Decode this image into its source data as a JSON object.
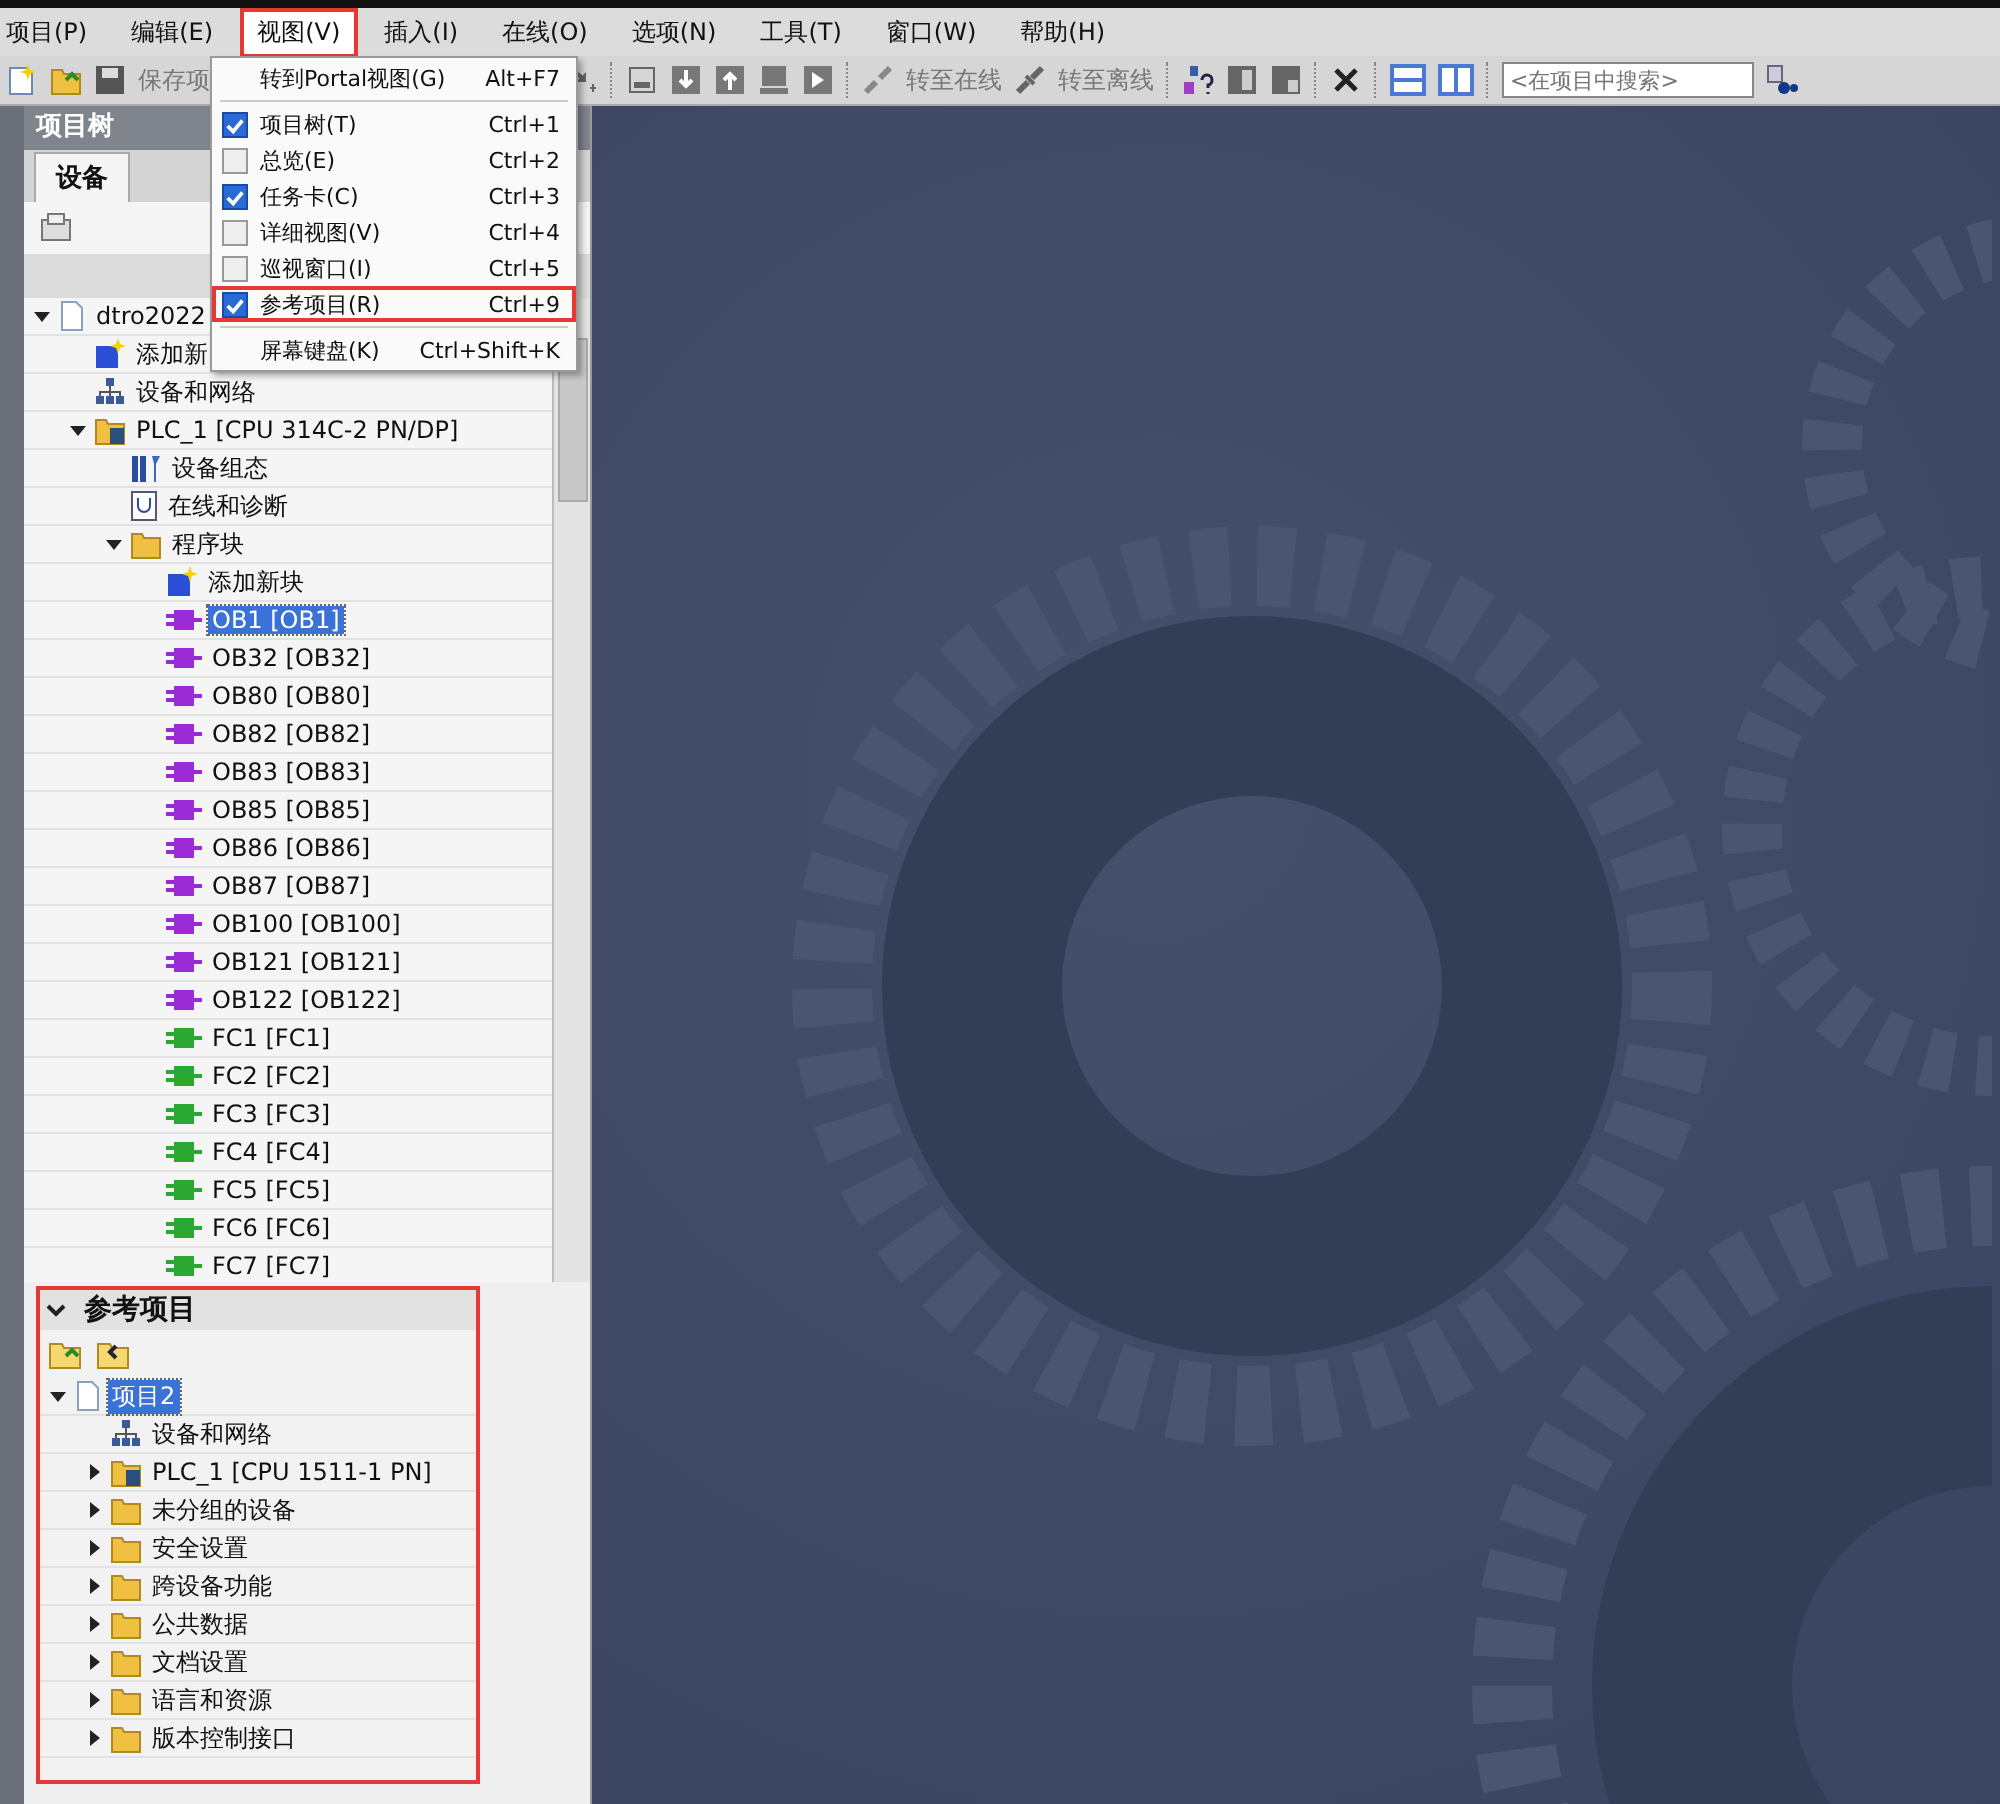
{
  "menu_bar": {
    "items": [
      {
        "label": "项目(P)",
        "open": false,
        "highlighted": false
      },
      {
        "label": "编辑(E)",
        "open": false,
        "highlighted": false
      },
      {
        "label": "视图(V)",
        "open": true,
        "highlighted": true
      },
      {
        "label": "插入(I)",
        "open": false,
        "highlighted": false
      },
      {
        "label": "在线(O)",
        "open": false,
        "highlighted": false
      },
      {
        "label": "选项(N)",
        "open": false,
        "highlighted": false
      },
      {
        "label": "工具(T)",
        "open": false,
        "highlighted": false
      },
      {
        "label": "窗口(W)",
        "open": false,
        "highlighted": false
      },
      {
        "label": "帮助(H)",
        "open": false,
        "highlighted": false
      }
    ]
  },
  "view_menu": {
    "groups": [
      [
        {
          "label": "转到Portal视图(G)",
          "shortcut": "Alt+F7",
          "kind": "plain"
        }
      ],
      [
        {
          "label": "项目树(T)",
          "shortcut": "Ctrl+1",
          "kind": "check",
          "checked": true,
          "highlighted": false
        },
        {
          "label": "总览(E)",
          "shortcut": "Ctrl+2",
          "kind": "check",
          "checked": false,
          "highlighted": false
        },
        {
          "label": "任务卡(C)",
          "shortcut": "Ctrl+3",
          "kind": "check",
          "checked": true,
          "highlighted": false
        },
        {
          "label": "详细视图(V)",
          "shortcut": "Ctrl+4",
          "kind": "check",
          "checked": false,
          "highlighted": false
        },
        {
          "label": "巡视窗口(I)",
          "shortcut": "Ctrl+5",
          "kind": "check",
          "checked": false,
          "highlighted": false
        },
        {
          "label": "参考项目(R)",
          "shortcut": "Ctrl+9",
          "kind": "check",
          "checked": true,
          "highlighted": true
        }
      ],
      [
        {
          "label": "屏幕键盘(K)",
          "shortcut": "Ctrl+Shift+K",
          "kind": "plain"
        }
      ]
    ]
  },
  "toolbar": {
    "save_label": "保存项",
    "go_online": "转至在线",
    "go_offline": "转至离线",
    "search": {
      "placeholder": "<在项目中搜索>"
    }
  },
  "project_tree": {
    "title": "项目树",
    "tabs": [
      {
        "label": "设备",
        "selected": true
      }
    ],
    "nodes": [
      {
        "label": "dtro2022",
        "kind": "project",
        "expanded": true,
        "selected": false,
        "children": [
          {
            "label": "添加新",
            "kind": "add",
            "selected": false
          },
          {
            "label": "设备和网络",
            "kind": "network",
            "selected": false
          },
          {
            "label": "PLC_1 [CPU 314C-2 PN/DP]",
            "kind": "plc",
            "expanded": true,
            "selected": false,
            "children": [
              {
                "label": "设备组态",
                "kind": "config",
                "selected": false
              },
              {
                "label": "在线和诊断",
                "kind": "diag",
                "selected": false
              },
              {
                "label": "程序块",
                "kind": "folder",
                "expanded": true,
                "selected": false,
                "children": [
                  {
                    "label": "添加新块",
                    "kind": "add",
                    "selected": false
                  },
                  {
                    "label": "OB1 [OB1]",
                    "kind": "ob",
                    "selected": true
                  },
                  {
                    "label": "OB32 [OB32]",
                    "kind": "ob",
                    "selected": false
                  },
                  {
                    "label": "OB80 [OB80]",
                    "kind": "ob",
                    "selected": false
                  },
                  {
                    "label": "OB82 [OB82]",
                    "kind": "ob",
                    "selected": false
                  },
                  {
                    "label": "OB83 [OB83]",
                    "kind": "ob",
                    "selected": false
                  },
                  {
                    "label": "OB85 [OB85]",
                    "kind": "ob",
                    "selected": false
                  },
                  {
                    "label": "OB86 [OB86]",
                    "kind": "ob",
                    "selected": false
                  },
                  {
                    "label": "OB87 [OB87]",
                    "kind": "ob",
                    "selected": false
                  },
                  {
                    "label": "OB100 [OB100]",
                    "kind": "ob",
                    "selected": false
                  },
                  {
                    "label": "OB121 [OB121]",
                    "kind": "ob",
                    "selected": false
                  },
                  {
                    "label": "OB122 [OB122]",
                    "kind": "ob",
                    "selected": false
                  },
                  {
                    "label": "FC1 [FC1]",
                    "kind": "fc",
                    "selected": false
                  },
                  {
                    "label": "FC2 [FC2]",
                    "kind": "fc",
                    "selected": false
                  },
                  {
                    "label": "FC3 [FC3]",
                    "kind": "fc",
                    "selected": false
                  },
                  {
                    "label": "FC4 [FC4]",
                    "kind": "fc",
                    "selected": false
                  },
                  {
                    "label": "FC5 [FC5]",
                    "kind": "fc",
                    "selected": false
                  },
                  {
                    "label": "FC6 [FC6]",
                    "kind": "fc",
                    "selected": false
                  },
                  {
                    "label": "FC7 [FC7]",
                    "kind": "fc",
                    "selected": false
                  }
                ]
              }
            ]
          }
        ]
      }
    ]
  },
  "reference_projects": {
    "title": "参考项目",
    "expanded": true,
    "highlighted": true,
    "nodes": [
      {
        "label": "项目2",
        "kind": "project",
        "expanded": true,
        "selected": true,
        "children": [
          {
            "label": "设备和网络",
            "kind": "network",
            "selected": false
          },
          {
            "label": "PLC_1 [CPU 1511-1 PN]",
            "kind": "plc",
            "expanded": false,
            "selected": false
          },
          {
            "label": "未分组的设备",
            "kind": "group",
            "expanded": false,
            "selected": false
          },
          {
            "label": "安全设置",
            "kind": "folder",
            "expanded": false,
            "selected": false
          },
          {
            "label": "跨设备功能",
            "kind": "folder",
            "expanded": false,
            "selected": false
          },
          {
            "label": "公共数据",
            "kind": "folder",
            "expanded": false,
            "selected": false
          },
          {
            "label": "文档设置",
            "kind": "folder",
            "expanded": false,
            "selected": false
          },
          {
            "label": "语言和资源",
            "kind": "folder",
            "expanded": false,
            "selected": false
          },
          {
            "label": "版本控制接口",
            "kind": "folder",
            "expanded": false,
            "selected": false
          }
        ]
      }
    ]
  }
}
